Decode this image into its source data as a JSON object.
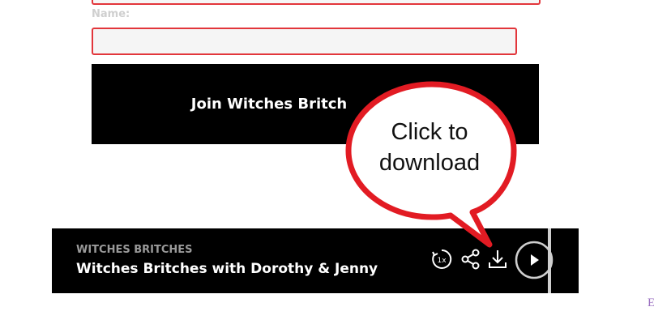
{
  "form": {
    "name_label": "Name:",
    "name_value": "",
    "join_button_label": "Join Witches Britch"
  },
  "player": {
    "podcast_name": "WITCHES BRITCHES",
    "episode_title": "Witches Britches with Dorothy & Jenny",
    "speed_label": "1x",
    "icons": [
      "speed-icon",
      "share-icon",
      "download-icon",
      "play-icon"
    ]
  },
  "callout": {
    "line1": "Click to",
    "line2": "download",
    "fill": "#ffffff",
    "stroke": "#e21b23"
  },
  "corner_glyph": "E"
}
